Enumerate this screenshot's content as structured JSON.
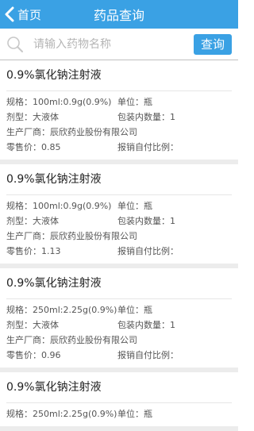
{
  "header": {
    "back_label": "首页",
    "title": "药品查询"
  },
  "search": {
    "placeholder": "请输入药物名称",
    "button_label": "查询"
  },
  "drugs": [
    {
      "name": "0.9%氯化钠注射液",
      "spec": "规格：100ml:0.9g(0.9%)",
      "unit": "单位：瓶",
      "form": "剂型：大液体",
      "pack": "包装内数量：1",
      "maker": "生产厂商：辰欣药业股份有限公司",
      "price": "零售价：0.85",
      "ratio": "报销自付比例："
    },
    {
      "name": "0.9%氯化钠注射液",
      "spec": "规格：100ml:0.9g(0.9%)",
      "unit": "单位：瓶",
      "form": "剂型：大液体",
      "pack": "包装内数量：1",
      "maker": "生产厂商：辰欣药业股份有限公司",
      "price": "零售价：1.13",
      "ratio": "报销自付比例："
    },
    {
      "name": "0.9%氯化钠注射液",
      "spec": "规格：250ml:2.25g(0.9%)",
      "unit": "单位：瓶",
      "form": "剂型：大液体",
      "pack": "包装内数量：1",
      "maker": "生产厂商：辰欣药业股份有限公司",
      "price": "零售价：0.96",
      "ratio": "报销自付比例："
    },
    {
      "name": "0.9%氯化钠注射液",
      "spec": "规格：250ml:2.25g(0.9%)",
      "unit": "单位：瓶"
    }
  ],
  "colors": {
    "accent": "#3aa1e4"
  }
}
